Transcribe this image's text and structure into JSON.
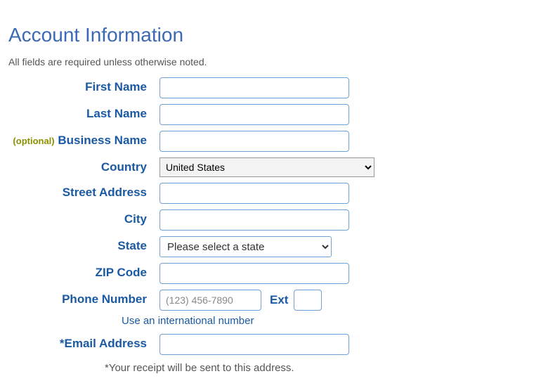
{
  "heading": "Account Information",
  "required_note": "All fields are required unless otherwise noted.",
  "labels": {
    "first_name": "First Name",
    "last_name": "Last Name",
    "business_optional": "(optional)",
    "business_name": "Business Name",
    "country": "Country",
    "street_address": "Street Address",
    "city": "City",
    "state": "State",
    "zip": "ZIP Code",
    "phone": "Phone Number",
    "ext": "Ext",
    "email": "*Email Address"
  },
  "values": {
    "first_name": "",
    "last_name": "",
    "business_name": "",
    "country_selected": "United States",
    "street_address": "",
    "city": "",
    "state_selected": "Please select a state",
    "zip": "",
    "phone": "",
    "ext": "",
    "email": ""
  },
  "placeholders": {
    "phone": "(123) 456-7890"
  },
  "links": {
    "intl_number": "Use an international number"
  },
  "notes": {
    "receipt": "*Your receipt will be sent to this address."
  }
}
